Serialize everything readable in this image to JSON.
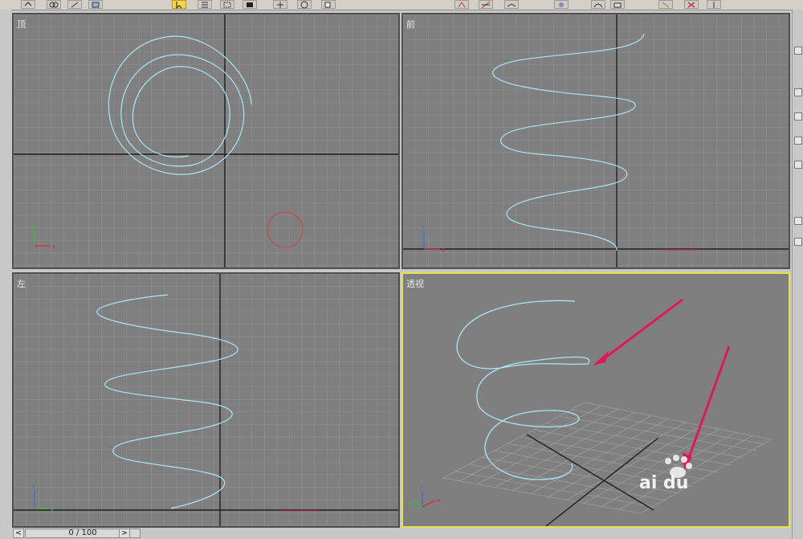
{
  "viewports": {
    "top": {
      "label": "顶"
    },
    "front": {
      "label": "前"
    },
    "left": {
      "label": "左"
    },
    "perspective": {
      "label": "透视"
    }
  },
  "timeline": {
    "frame_readout": "0 / 100",
    "prev_symbol": "<",
    "next_symbol": ">"
  },
  "colors": {
    "viewport_bg": "#7f7f7f",
    "grid": "#9a9a9a",
    "axis_line": "#1f1f1f",
    "helix": "#a9e7f2",
    "active_border": "#e8e04a",
    "arrow": "#e0185a",
    "selection": "#d04050"
  },
  "icons": [
    "select-arrow-icon",
    "move-icon",
    "rotate-icon",
    "scale-icon",
    "snap-icon",
    "mirror-icon",
    "align-icon",
    "material-icon",
    "render-icon",
    "watermark-icon"
  ],
  "watermark": {
    "text": "ai du"
  }
}
